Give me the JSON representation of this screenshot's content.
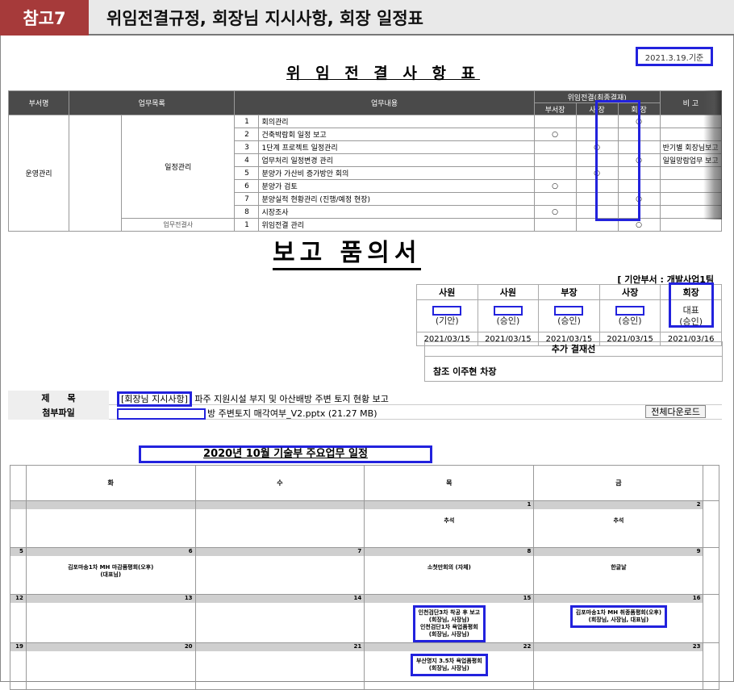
{
  "header": {
    "tag": "참고7",
    "title": "위임전결규정, 회장님 지시사항, 회장 일정표"
  },
  "delegation": {
    "date_label": "2021.3.19.기준",
    "title": "위 임 전 결 사 항 표",
    "col_dept": "부서명",
    "col_category": "업무목록",
    "col_content": "업무내용",
    "col_group": "위임전결(최종결재)",
    "col_head": "부서장",
    "col_president": "사 장",
    "col_chairman": "회 장",
    "col_note": "비 고",
    "dept_name": "운영관리",
    "category_name": "일정관리",
    "next_category": "업무전결사",
    "rows": [
      {
        "no": "1",
        "content": "회의관리",
        "head": "",
        "president": "",
        "chairman": "○",
        "note": ""
      },
      {
        "no": "2",
        "content": "건축박람회 일정 보고",
        "head": "○",
        "president": "",
        "chairman": "",
        "note": ""
      },
      {
        "no": "3",
        "content": "1단계 프로젝트 일정관리",
        "head": "",
        "president": "○",
        "chairman": "",
        "note": "반기별 회장님보고"
      },
      {
        "no": "4",
        "content": "업무처리 일정변경 관리",
        "head": "",
        "president": "",
        "chairman": "○",
        "note": "일일망람업무 보고"
      },
      {
        "no": "5",
        "content": "분양가 가산비 증가방안 회의",
        "head": "",
        "president": "○",
        "chairman": "",
        "note": ""
      },
      {
        "no": "6",
        "content": "분양가 검토",
        "head": "○",
        "president": "",
        "chairman": "",
        "note": ""
      },
      {
        "no": "7",
        "content": "분양실적 현황관리 (진행/예정 현장)",
        "head": "",
        "president": "",
        "chairman": "○",
        "note": ""
      },
      {
        "no": "8",
        "content": "시장조사",
        "head": "○",
        "president": "",
        "chairman": "",
        "note": ""
      },
      {
        "no": "1",
        "content": "위임전결 관리",
        "head": "",
        "president": "",
        "chairman": "○",
        "note": ""
      }
    ]
  },
  "report": {
    "title": "보고 품의서",
    "dept": "[ 기안부서 : 개발사업1팀",
    "approvers": [
      {
        "role": "사원",
        "status": "(기안)",
        "date": "2021/03/15"
      },
      {
        "role": "사원",
        "status": "(승인)",
        "date": "2021/03/15"
      },
      {
        "role": "부장",
        "status": "(승인)",
        "date": "2021/03/15"
      },
      {
        "role": "사장",
        "status": "(승인)",
        "date": "2021/03/15"
      },
      {
        "role": "회장",
        "status_top": "대표",
        "status": "(승인)",
        "date": "2021/03/16"
      }
    ],
    "add_header": "추가 결재선",
    "add_body": "참조 이주현 차장",
    "subject_label": "제　　목",
    "subject_tag": "[회장님 지시사항]",
    "subject_text": "파주 지원시설 부지 및 아산배방 주변 토지 현황 보고",
    "attach_label": "첨부파일",
    "attach_text": "방 주변토지 매각여부_V2.pptx (21.27 MB)",
    "download": "전체다운로드"
  },
  "calendar": {
    "title": "2020년 10월 기술부 주요업무 일정",
    "days": [
      "화",
      "수",
      "목",
      "금"
    ],
    "weeks": [
      {
        "nums": [
          "",
          "",
          "",
          "1",
          "2"
        ],
        "events": [
          "",
          "",
          "",
          "추석",
          "추석"
        ]
      },
      {
        "nums": [
          "5",
          "6",
          "7",
          "8",
          "9"
        ],
        "events": [
          "",
          "김포마송1차 MH 마감품평회(오후)\n(대표님)",
          "",
          "소첫만회의 (자체)",
          "한글날"
        ]
      },
      {
        "nums": [
          "12",
          "13",
          "14",
          "15",
          "16"
        ],
        "events": [
          "",
          "",
          "",
          "인천검단3차 착공 후 보고\n(회장님, 사장님)\n인천검단1차 욕업품평회\n(회장님, 사장님)",
          "김포마송1차 MH 취종품평회(오후)\n(회장님, 사장님, 대표님)"
        ]
      },
      {
        "nums": [
          "19",
          "20",
          "21",
          "22",
          "23"
        ],
        "events": [
          "",
          "",
          "",
          "부산명지 3.5차 욕업품평회\n(회장님, 사장님)",
          ""
        ]
      }
    ]
  }
}
